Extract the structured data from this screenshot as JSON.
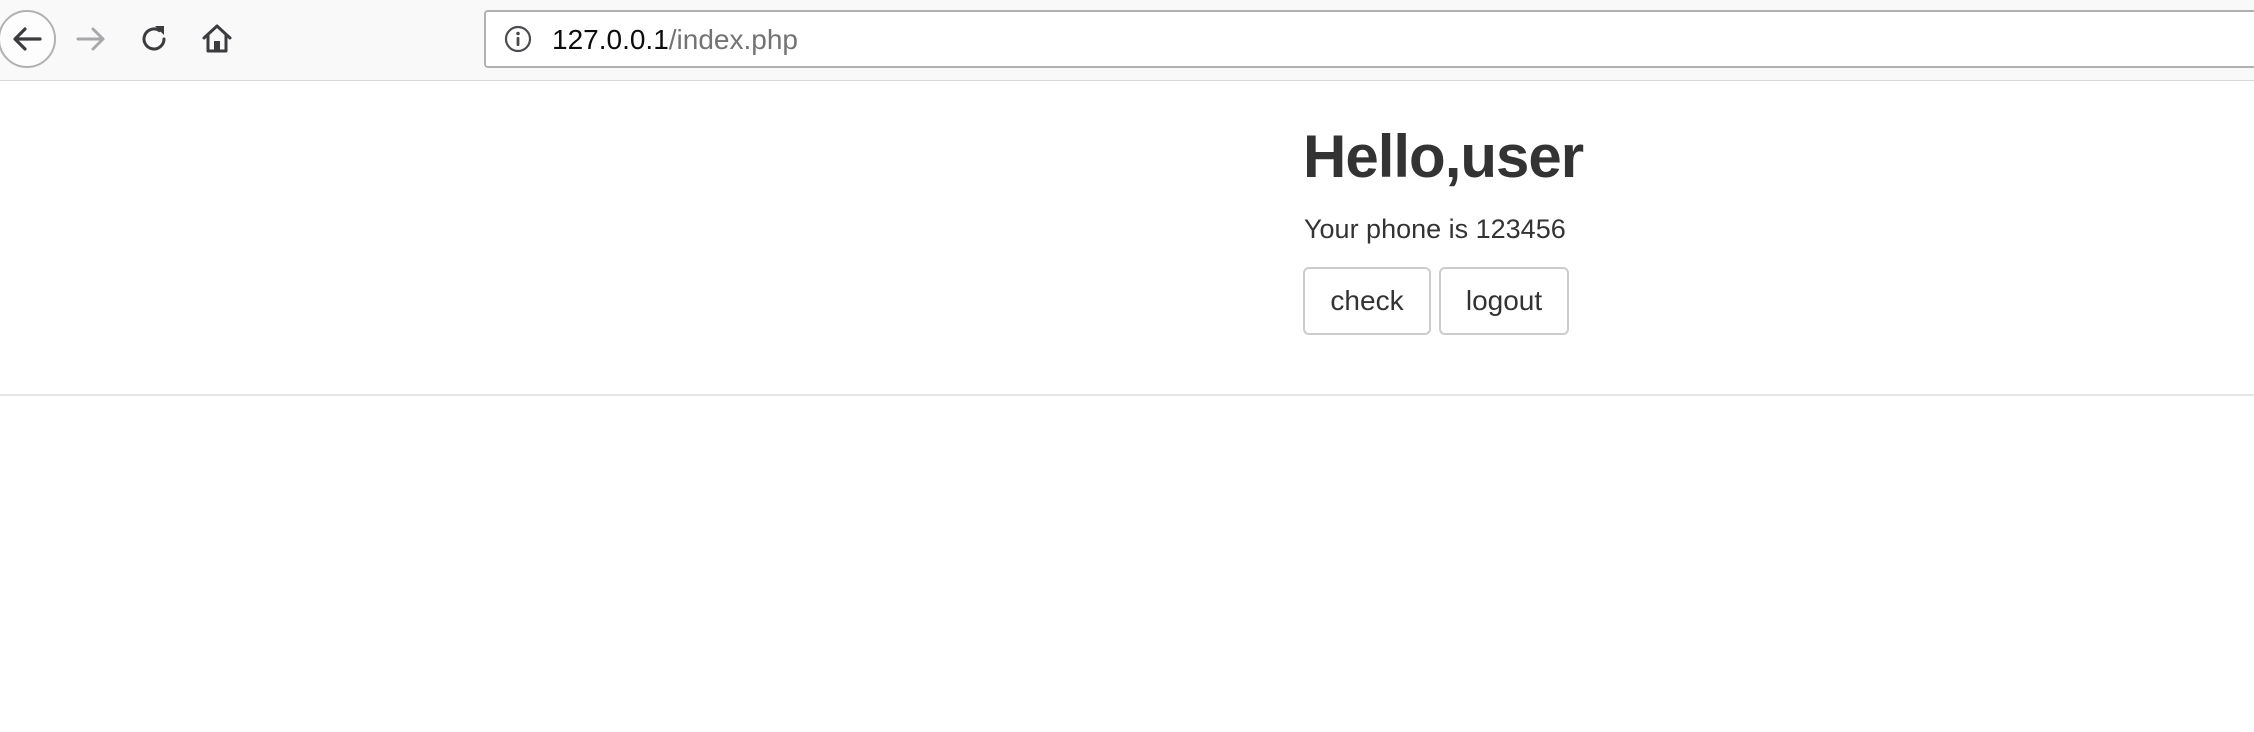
{
  "browser": {
    "url": {
      "host": "127.0.0.1",
      "path": "/index.php"
    },
    "icons": {
      "back": "back-arrow-icon",
      "forward": "forward-arrow-icon",
      "reload": "reload-icon",
      "home": "home-icon",
      "site_info": "info-icon"
    }
  },
  "page": {
    "greeting": "Hello,user",
    "phone_text": "Your phone is 123456",
    "buttons": {
      "check": "check",
      "logout": "logout"
    }
  },
  "colors": {
    "text": "#333333",
    "toolbar_bg": "#f9f9fa",
    "button_border": "#cccccc",
    "url_path": "#737373"
  }
}
